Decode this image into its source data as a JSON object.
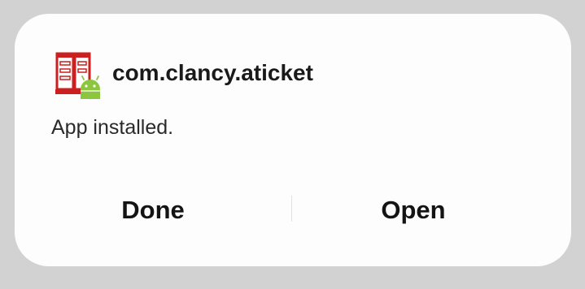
{
  "dialog": {
    "package_name": "com.clancy.aticket",
    "status": "App installed.",
    "app_icon": "aticket-app-icon",
    "android_badge_icon": "android-icon",
    "buttons": {
      "done_label": "Done",
      "open_label": "Open"
    }
  },
  "colors": {
    "background": "#d2d2d2",
    "dialog": "#fdfdfd",
    "icon_red": "#cc1f1f",
    "android_green": "#8cc63f"
  }
}
